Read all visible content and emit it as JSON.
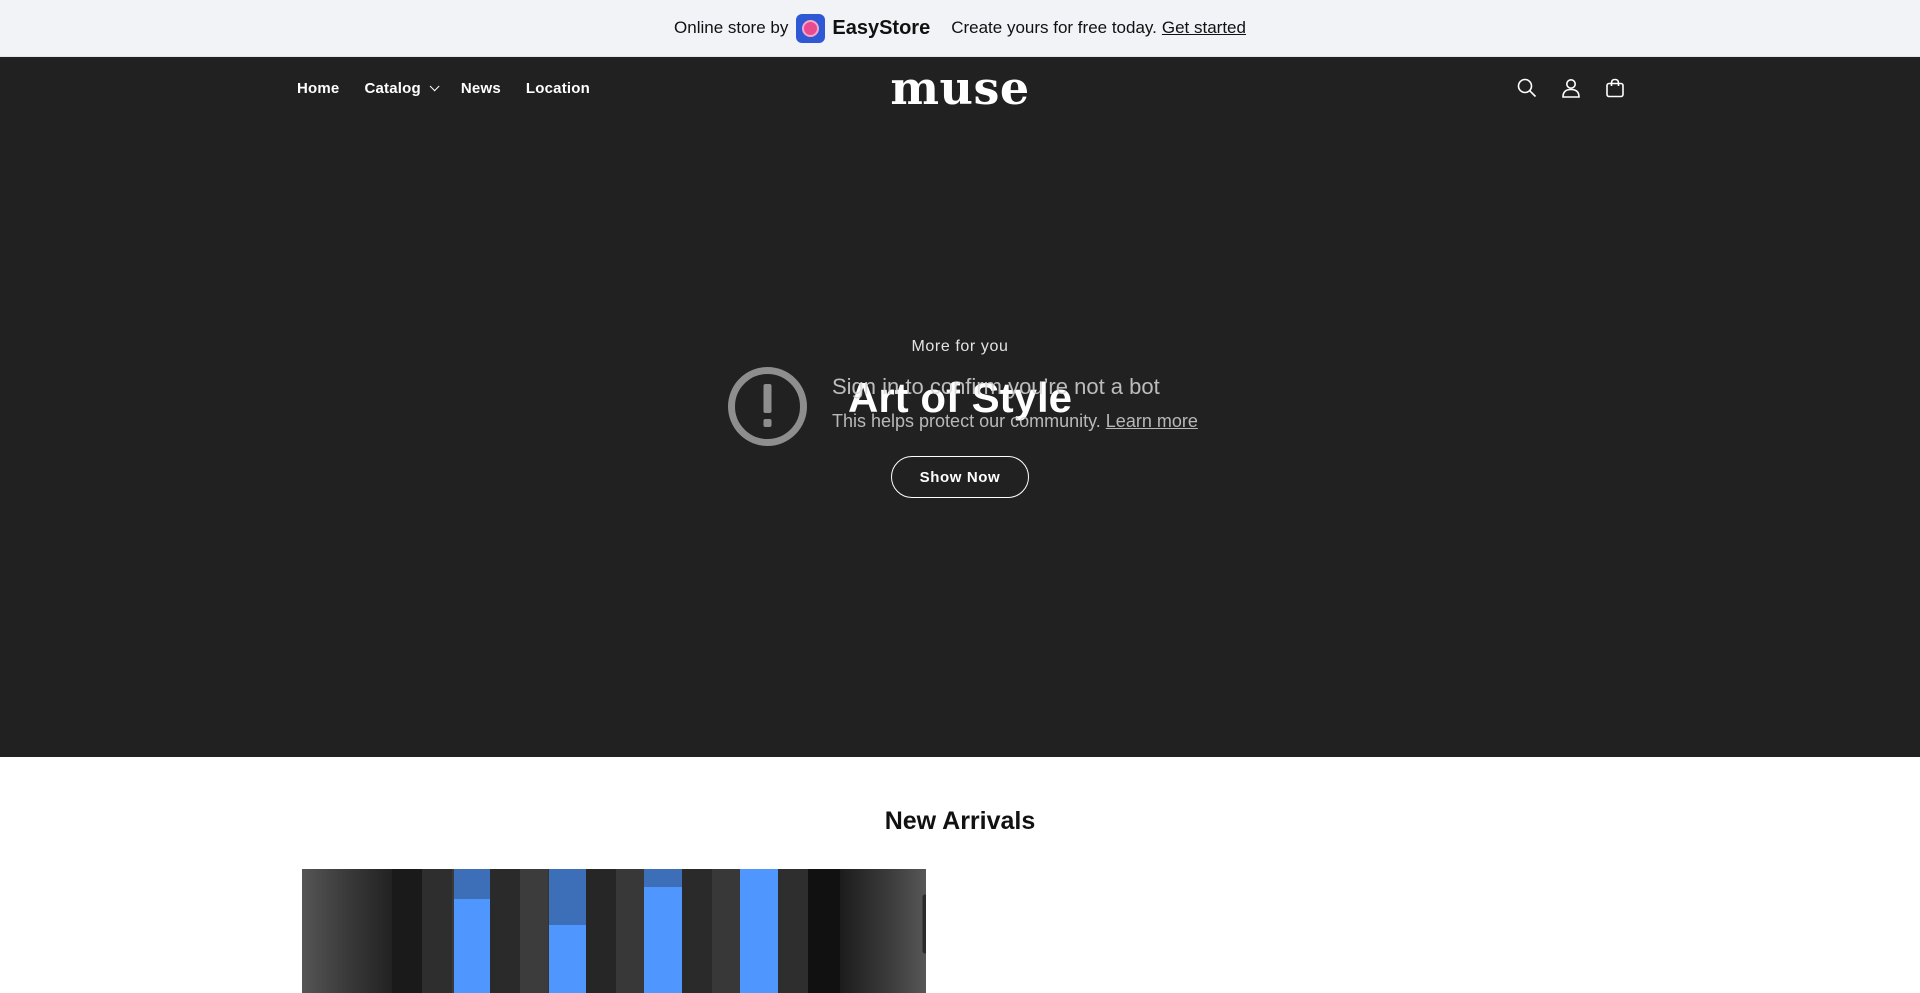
{
  "promo": {
    "prefix": "Online store by",
    "brand": "EasyStore",
    "message": "Create yours for free today.",
    "cta": "Get started",
    "badge_icon": "easystore-logo-icon",
    "badge_color": "#2f58d4"
  },
  "header": {
    "nav": [
      {
        "label": "Home"
      },
      {
        "label": "Catalog",
        "has_dropdown": true
      },
      {
        "label": "News"
      },
      {
        "label": "Location"
      }
    ],
    "logo": "muse",
    "icons": [
      "search-icon",
      "account-icon",
      "cart-icon"
    ],
    "background": "#212121"
  },
  "hero": {
    "subtitle": "More for you",
    "title": "Art of Style",
    "button": "Show Now"
  },
  "bot_check": {
    "icon": "exclamation-circle-icon",
    "title": "Sign in to confirm you’re not a bot",
    "text": "This helps protect our community.",
    "link": "Learn more"
  },
  "new_arrivals": {
    "title": "New Arrivals",
    "accent": "#4f96ff"
  }
}
